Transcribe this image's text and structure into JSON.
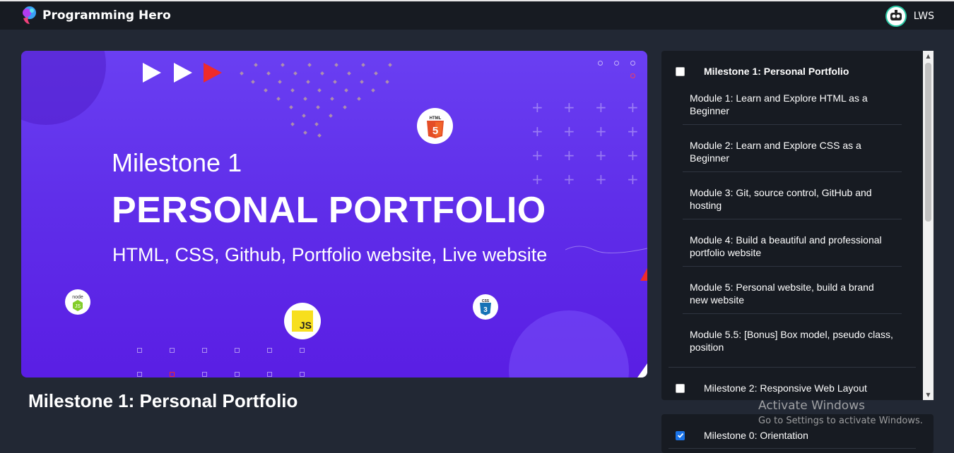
{
  "header": {
    "brand": "Programming Hero",
    "user_name": "LWS"
  },
  "banner": {
    "title": "Milestone 1",
    "headline": "PERSONAL PORTFOLIO",
    "subtitle": "HTML, CSS, Github, Portfolio website, Live website",
    "badges": {
      "html5": "HTML",
      "node": "node",
      "js": "JS",
      "css3": "CSS"
    }
  },
  "lesson": {
    "title": "Milestone 1: Personal Portfolio"
  },
  "sidebar": {
    "milestones": [
      {
        "label": "Milestone 1: Personal Portfolio",
        "checked": false,
        "modules": [
          "Module 1: Learn and Explore HTML as a Beginner",
          "Module 2: Learn and Explore CSS as a Beginner",
          "Module 3: Git, source control, GitHub and hosting",
          "Module 4: Build a beautiful and professional portfolio website",
          "Module 5: Personal website, build a brand new website",
          "Module 5.5: [Bonus] Box model, pseudo class, position"
        ]
      },
      {
        "label": "Milestone 2: Responsive Web Layout",
        "checked": false
      }
    ],
    "orientation": {
      "label": "Milestone 0: Orientation",
      "checked": true
    }
  },
  "watermark": {
    "line1": "Activate Windows",
    "line2": "Go to Settings to activate Windows."
  },
  "colors": {
    "background": "#222834",
    "panel": "#171b22",
    "banner_purple": "#5f2de9",
    "accent_red": "#ee2b2b"
  }
}
